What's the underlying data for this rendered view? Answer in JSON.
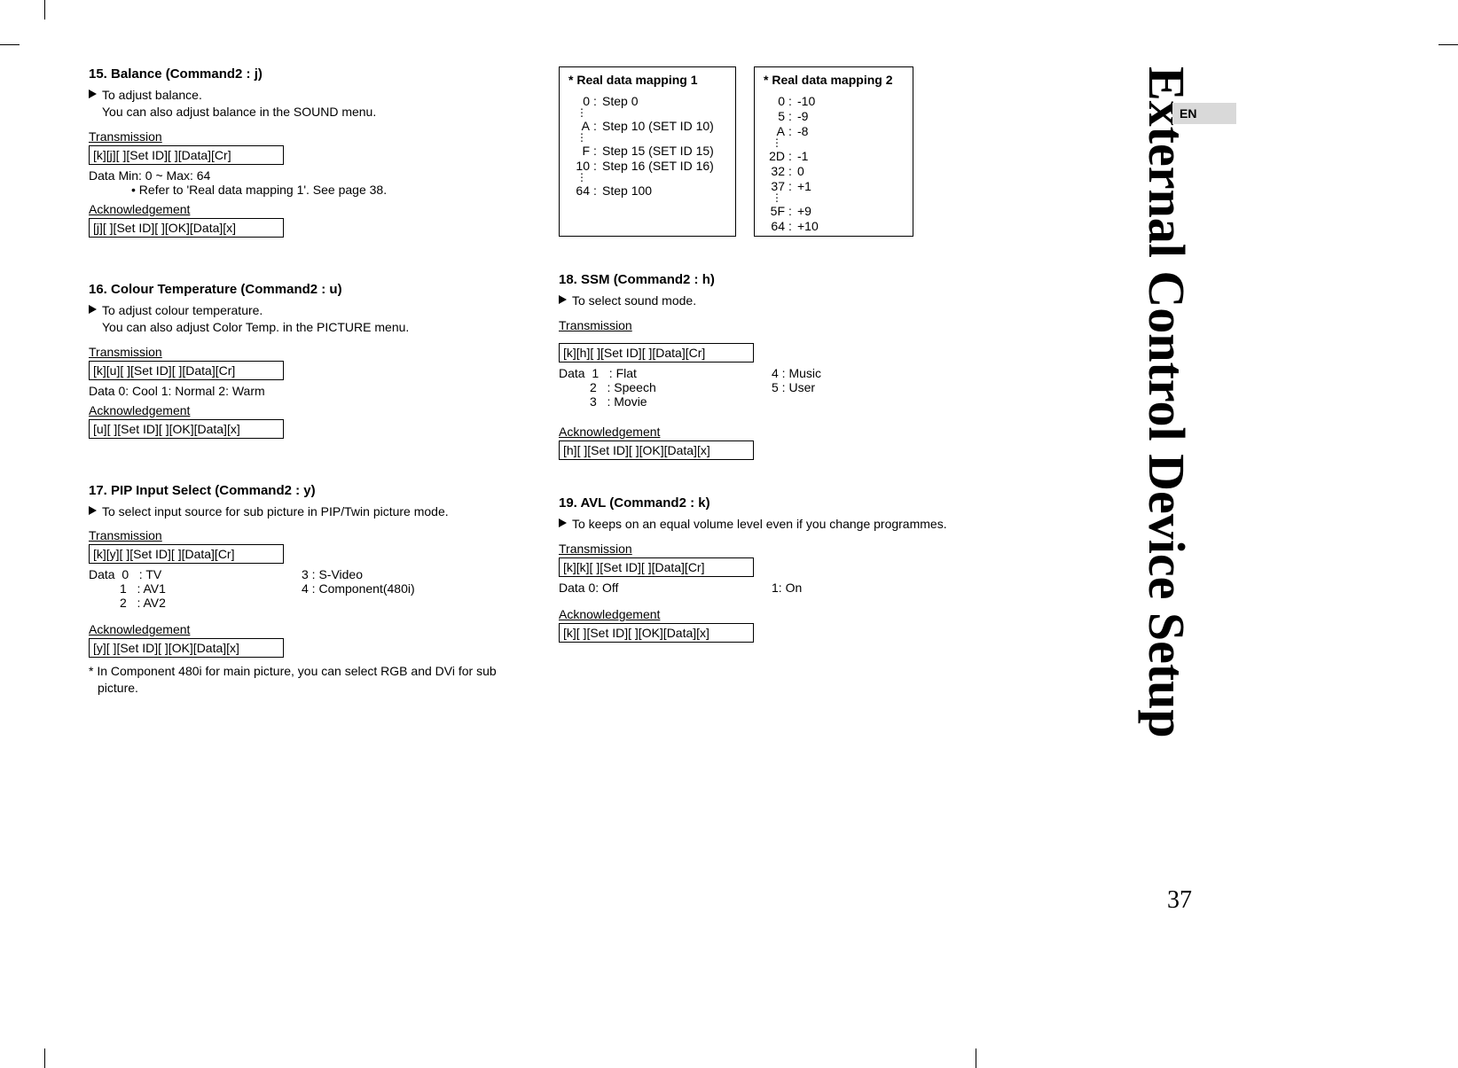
{
  "page": {
    "side_title": "External Control Device Setup",
    "lang": "EN",
    "page_number": "37"
  },
  "left": {
    "s15": {
      "title": "15. Balance (Command2 : j)",
      "desc": "To adjust balance.",
      "desc2": "You can also adjust balance in the SOUND menu.",
      "tx_label": "Transmission",
      "tx_code": "[k][j][  ][Set ID][  ][Data][Cr]",
      "data_line": "Data   Min: 0 ~ Max: 64",
      "note": "Refer to 'Real data mapping 1'. See page 38.",
      "ack_label": "Acknowledgement",
      "ack_code": "[j][  ][Set ID][  ][OK][Data][x]"
    },
    "s16": {
      "title": "16. Colour Temperature (Command2 : u)",
      "desc": "To adjust colour temperature.",
      "desc2": "You can also adjust Color Temp. in the PICTURE menu.",
      "tx_label": "Transmission",
      "tx_code": "[k][u][  ][Set ID][  ][Data][Cr]",
      "data_line": "Data   0: Cool    1: Normal    2: Warm",
      "ack_label": "Acknowledgement",
      "ack_code": "[u][  ][Set ID][  ][OK][Data][x]"
    },
    "s17": {
      "title": "17. PIP Input Select (Command2 : y)",
      "desc": "To select input source for sub picture in PIP/Twin picture mode.",
      "tx_label": "Transmission",
      "tx_code": "[k][y][  ][Set ID][  ][Data][Cr]",
      "d0": "Data  0   : TV",
      "d1": "         1   : AV1",
      "d2": "         2   : AV2",
      "d3": "3   : S-Video",
      "d4": "4   : Component(480i)",
      "ack_label": "Acknowledgement",
      "ack_code": "[y][  ][Set ID][  ][OK][Data][x]",
      "foot": "* In Component 480i for main picture, you can select RGB and DVi for sub picture."
    }
  },
  "right": {
    "map1": {
      "title": "*  Real data mapping 1",
      "r0k": "0",
      "r0v": "Step 0",
      "r1k": "A",
      "r1v": "Step 10 (SET ID 10)",
      "r2k": "F",
      "r2v": "Step 15 (SET ID 15)",
      "r3k": "10",
      "r3v": "Step 16 (SET ID 16)",
      "r4k": "64",
      "r4v": "Step 100"
    },
    "map2": {
      "title": "*  Real data mapping 2",
      "r0k": "0",
      "r0v": "-10",
      "r1k": "5",
      "r1v": "-9",
      "r2k": "A",
      "r2v": "-8",
      "r3k": "2D",
      "r3v": "-1",
      "r4k": "32",
      "r4v": "0",
      "r5k": "37",
      "r5v": "+1",
      "r6k": "5F",
      "r6v": "+9",
      "r7k": "64",
      "r7v": "+10"
    },
    "s18": {
      "title": "18. SSM (Command2 : h)",
      "desc": "To select sound mode.",
      "tx_label": "Transmission",
      "tx_code": "[k][h][  ][Set ID][  ][Data][Cr]",
      "d1": "Data  1   : Flat",
      "d2": "         2   : Speech",
      "d3": "         3   : Movie",
      "d4": "4   : Music",
      "d5": "5   : User",
      "ack_label": "Acknowledgement",
      "ack_code": "[h][  ][Set ID][  ][OK][Data][x]"
    },
    "s19": {
      "title": "19. AVL (Command2 : k)",
      "desc": "To keeps on an equal volume level even if you change programmes.",
      "tx_label": "Transmission",
      "tx_code": "[k][k][  ][Set ID][  ][Data][Cr]",
      "data_line_l": "Data   0: Off",
      "data_line_r": "1: On",
      "ack_label": "Acknowledgement",
      "ack_code": "[k][  ][Set ID][  ][OK][Data][x]"
    }
  }
}
